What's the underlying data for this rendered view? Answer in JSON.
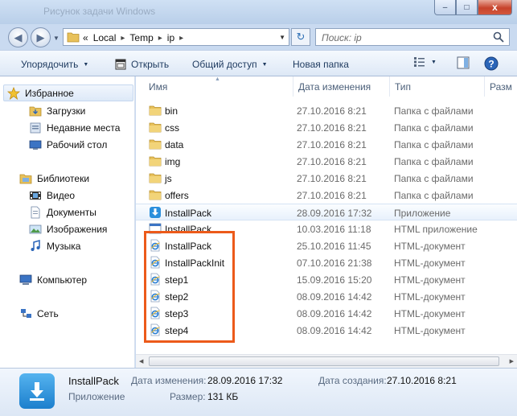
{
  "window": {
    "title": "Рисунок задачи Windows",
    "controls": {
      "minimize": "–",
      "maximize": "□",
      "close": "x"
    }
  },
  "address": {
    "overflow": "«",
    "path": [
      "Local",
      "Temp",
      "ip"
    ],
    "search_placeholder": "Поиск: ip"
  },
  "toolbar": {
    "organize": "Упорядочить",
    "open": "Открыть",
    "share": "Общий доступ",
    "new_folder": "Новая папка"
  },
  "nav": {
    "favorites": "Избранное",
    "downloads": "Загрузки",
    "recent": "Недавние места",
    "desktop": "Рабочий стол",
    "libraries": "Библиотеки",
    "video": "Видео",
    "documents": "Документы",
    "images": "Изображения",
    "music": "Музыка",
    "computer": "Компьютер",
    "network": "Сеть"
  },
  "columns": {
    "name": "Имя",
    "date": "Дата изменения",
    "type": "Тип",
    "size": "Разм"
  },
  "files": [
    {
      "name": "bin",
      "date": "27.10.2016 8:21",
      "type": "Папка с файлами",
      "icon": "folder-icon"
    },
    {
      "name": "css",
      "date": "27.10.2016 8:21",
      "type": "Папка с файлами",
      "icon": "folder-icon"
    },
    {
      "name": "data",
      "date": "27.10.2016 8:21",
      "type": "Папка с файлами",
      "icon": "folder-icon"
    },
    {
      "name": "img",
      "date": "27.10.2016 8:21",
      "type": "Папка с файлами",
      "icon": "folder-icon"
    },
    {
      "name": "js",
      "date": "27.10.2016 8:21",
      "type": "Папка с файлами",
      "icon": "folder-icon"
    },
    {
      "name": "offers",
      "date": "27.10.2016 8:21",
      "type": "Папка с файлами",
      "icon": "folder-icon"
    },
    {
      "name": "InstallPack",
      "date": "28.09.2016 17:32",
      "type": "Приложение",
      "icon": "installer-icon"
    },
    {
      "name": "InstallPack",
      "date": "10.03.2016 11:18",
      "type": "HTML приложение",
      "icon": "hta-icon"
    },
    {
      "name": "InstallPack",
      "date": "25.10.2016 11:45",
      "type": "HTML-документ",
      "icon": "ie-document-icon"
    },
    {
      "name": "InstallPackInit",
      "date": "07.10.2016 21:38",
      "type": "HTML-документ",
      "icon": "ie-document-icon"
    },
    {
      "name": "step1",
      "date": "15.09.2016 15:20",
      "type": "HTML-документ",
      "icon": "ie-document-icon"
    },
    {
      "name": "step2",
      "date": "08.09.2016 14:42",
      "type": "HTML-документ",
      "icon": "ie-document-icon"
    },
    {
      "name": "step3",
      "date": "08.09.2016 14:42",
      "type": "HTML-документ",
      "icon": "ie-document-icon"
    },
    {
      "name": "step4",
      "date": "08.09.2016 14:42",
      "type": "HTML-документ",
      "icon": "ie-document-icon"
    }
  ],
  "selected_index": 6,
  "details": {
    "name": "InstallPack",
    "kind": "Приложение",
    "modified_label": "Дата изменения:",
    "modified_value": "28.09.2016 17:32",
    "created_label": "Дата создания:",
    "created_value": "27.10.2016 8:21",
    "size_label": "Размер:",
    "size_value": "131 КБ"
  },
  "colors": {
    "highlight_box": "#ec5a1a",
    "accent": "#1c7fcd"
  }
}
